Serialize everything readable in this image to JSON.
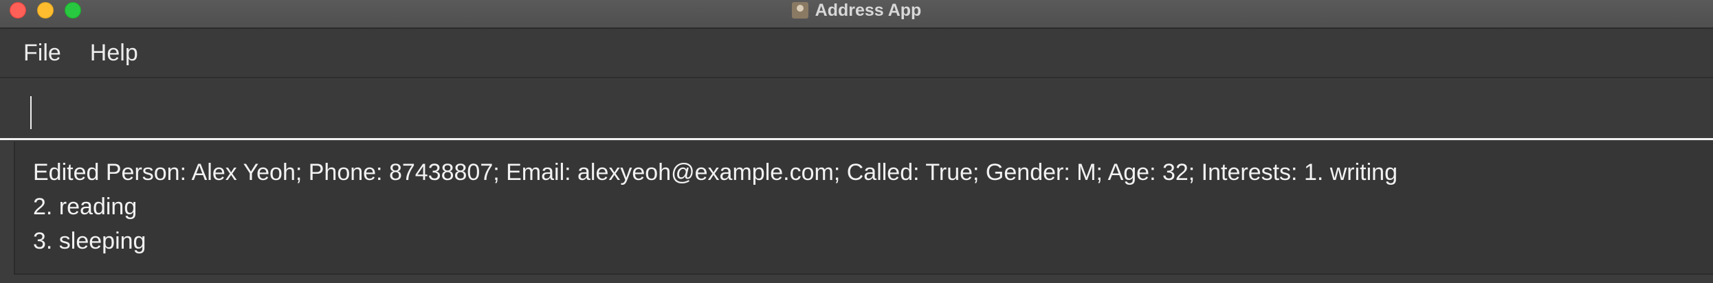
{
  "window": {
    "title": "Address App",
    "app_icon": "address-book-icon",
    "traffic_lights": {
      "close_color": "#fe5f57",
      "minimize_color": "#febc2e",
      "maximize_color": "#28c840"
    }
  },
  "menubar": {
    "items": [
      {
        "label": "File"
      },
      {
        "label": "Help"
      }
    ]
  },
  "command": {
    "value": "",
    "placeholder": ""
  },
  "result": {
    "lines": [
      "Edited Person: Alex Yeoh; Phone: 87438807; Email: alexyeoh@example.com; Called: True; Gender: M; Age: 32; Interests: 1. writing",
      "2. reading",
      "3. sleeping"
    ]
  }
}
